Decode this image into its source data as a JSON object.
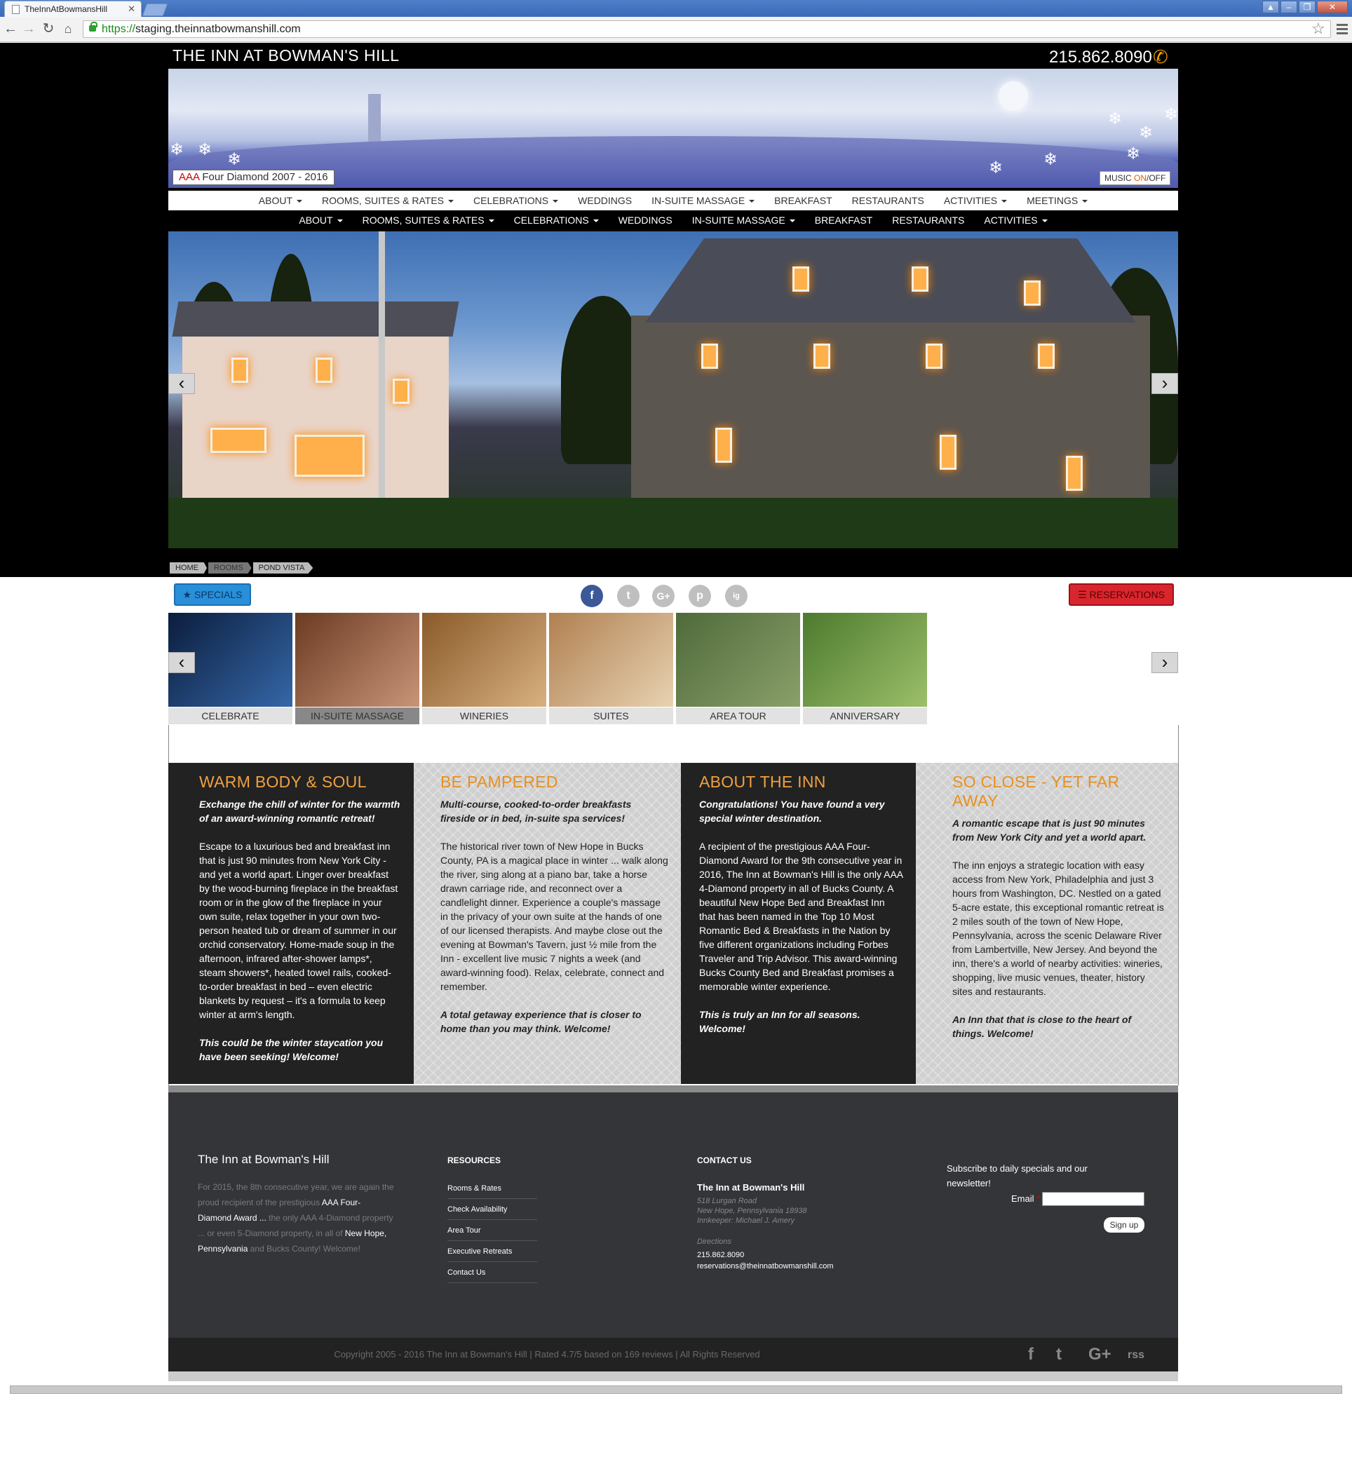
{
  "browser": {
    "tab_title": "TheInnAtBowmansHill",
    "url_scheme": "https://",
    "url_rest": "staging.theinnatbowmanshill.com"
  },
  "site": {
    "logo": "THE INN AT BOWMAN'S HILL",
    "phone": "215.862.8090",
    "award_prefix": "AAA",
    "award_text": "Four Diamond 2007 - 2016",
    "music_label": "MUSIC",
    "music_on": "ON",
    "music_off": "/OFF"
  },
  "nav_primary": [
    {
      "label": "ABOUT",
      "dropdown": true
    },
    {
      "label": "ROOMS, SUITES & RATES",
      "dropdown": true
    },
    {
      "label": "CELEBRATIONS",
      "dropdown": true
    },
    {
      "label": "WEDDINGS",
      "dropdown": false
    },
    {
      "label": "IN-SUITE MASSAGE",
      "dropdown": true
    },
    {
      "label": "BREAKFAST",
      "dropdown": false
    },
    {
      "label": "RESTAURANTS",
      "dropdown": false
    },
    {
      "label": "ACTIVITIES",
      "dropdown": true
    },
    {
      "label": "MEETINGS",
      "dropdown": true
    }
  ],
  "nav_secondary": [
    {
      "label": "ABOUT",
      "dropdown": true
    },
    {
      "label": "ROOMS, SUITES & RATES",
      "dropdown": true
    },
    {
      "label": "CELEBRATIONS",
      "dropdown": true
    },
    {
      "label": "WEDDINGS",
      "dropdown": false
    },
    {
      "label": "IN-SUITE MASSAGE",
      "dropdown": true
    },
    {
      "label": "BREAKFAST",
      "dropdown": false
    },
    {
      "label": "RESTAURANTS",
      "dropdown": false
    },
    {
      "label": "ACTIVITIES",
      "dropdown": true
    }
  ],
  "breadcrumb": [
    "HOME",
    "ROOMS",
    "POND VISTA"
  ],
  "actions": {
    "specials": "SPECIALS",
    "reservations": "RESERVATIONS"
  },
  "social": [
    "f",
    "t",
    "G+",
    "p",
    "ig"
  ],
  "thumbs": [
    {
      "label": "CELEBRATE",
      "active": false,
      "colors": [
        "#0b1d3c",
        "#3567a8"
      ]
    },
    {
      "label": "IN-SUITE MASSAGE",
      "active": true,
      "colors": [
        "#6b3b22",
        "#c99478"
      ]
    },
    {
      "label": "WINERIES",
      "active": false,
      "colors": [
        "#8a5a2a",
        "#d8b080"
      ]
    },
    {
      "label": "SUITES",
      "active": false,
      "colors": [
        "#b08050",
        "#e8d2b2"
      ]
    },
    {
      "label": "AREA TOUR",
      "active": false,
      "colors": [
        "#4f6a3a",
        "#8aa06a"
      ]
    },
    {
      "label": "ANNIVERSARY",
      "active": false,
      "colors": [
        "#4d7a2e",
        "#9cbf6a"
      ]
    }
  ],
  "columns": [
    {
      "title": "WARM BODY & SOUL",
      "lead": "Exchange the chill of winter for the warmth of an award-winning romantic retreat!",
      "body": "Escape to a luxurious bed and breakfast inn that is just 90 minutes from New York City - and yet a world apart. Linger over breakfast by the wood-burning fireplace in the breakfast room or in the glow of the fireplace in your own suite, relax together in your own two-person heated tub or dream of summer in our orchid conservatory. Home-made soup in the afternoon, infrared after-shower lamps*, steam showers*, heated towel rails, cooked-to-order breakfast in bed – even electric blankets by request – it's a formula to keep winter at arm's length.",
      "tail": "This could be the winter staycation you have been seeking! Welcome!"
    },
    {
      "title": "BE PAMPERED",
      "lead": "Multi-course, cooked-to-order breakfasts fireside or in bed, in-suite spa services!",
      "body": "The historical river town of New Hope in Bucks County, PA is a magical place in winter ... walk along the river, sing along at a piano bar, take a horse drawn carriage ride, and reconnect over a candlelight dinner. Experience a couple's massage in the privacy of your own suite at the hands of one of our licensed therapists. And maybe close out the evening at Bowman's Tavern, just ½ mile from the Inn - excellent live music 7 nights a week (and award-winning food). Relax, celebrate, connect and remember.",
      "tail": "A total getaway experience that is closer to home than you may think. Welcome!"
    },
    {
      "title": "ABOUT THE INN",
      "lead": "Congratulations! You have found a very special winter destination.",
      "body": "A recipient of the prestigious AAA Four-Diamond Award for the 9th consecutive year in 2016, The Inn at Bowman's Hill is the only AAA 4-Diamond property in all of Bucks County. A beautiful New Hope Bed and Breakfast Inn that has been named in the Top 10 Most Romantic Bed & Breakfasts in the Nation by five different organizations including Forbes Traveler and Trip Advisor. This award-winning Bucks County Bed and Breakfast promises a memorable winter experience.",
      "tail": "This is truly an Inn for all seasons. Welcome!"
    },
    {
      "title": "SO CLOSE - YET FAR AWAY",
      "lead": "A romantic escape that is just 90 minutes from New York City and yet a world apart.",
      "body": "The inn enjoys a strategic location with easy access from New York, Philadelphia and just 3 hours from Washington, DC. Nestled on a gated 5-acre estate, this exceptional romantic retreat is 2 miles south of the town of New Hope, Pennsylvania, across the scenic Delaware River from Lambertville, New Jersey. And beyond the inn, there's a world of nearby activities: wineries, shopping, live music venues, theater, history sites and restaurants.",
      "tail": "An Inn that that is close to the heart of things. Welcome!"
    }
  ],
  "footer": {
    "name": "The Inn at Bowman's Hill",
    "about_1": "For 2015, the 8th consecutive year, we are again the proud recipient of the prestigious ",
    "about_b1": "AAA Four-Diamond Award ...",
    "about_2": " the only AAA 4-Diamond property ... or even 5-Diamond property, in all of ",
    "about_b2": "New Hope, Pennsylvania",
    "about_3": " and Bucks County! Welcome!",
    "resources_title": "RESOURCES",
    "resources": [
      "Rooms & Rates",
      "Check Availability",
      "Area Tour",
      "Executive Retreats",
      "Contact Us"
    ],
    "contact_title": "CONTACT US",
    "contact_name": "The Inn at Bowman's Hill",
    "address1": "518 Lurgan Road",
    "address2": "New Hope, Pennsylvania 18938",
    "innkeeper": "Innkeeper: Michael J. Amery",
    "directions": "Directions",
    "phone": "215.862.8090",
    "email": "reservations@theinnatbowmanshill.com",
    "subscribe": "Subscribe to daily specials and our newsletter!",
    "email_label": "Email",
    "signup": "Sign up",
    "copyright": "Copyright 2005 - 2016 The Inn at Bowman's Hill | Rated 4.7/5 based on 169 reviews | All Rights Reserved",
    "social": [
      "f",
      "t",
      "G+",
      "rss"
    ]
  }
}
